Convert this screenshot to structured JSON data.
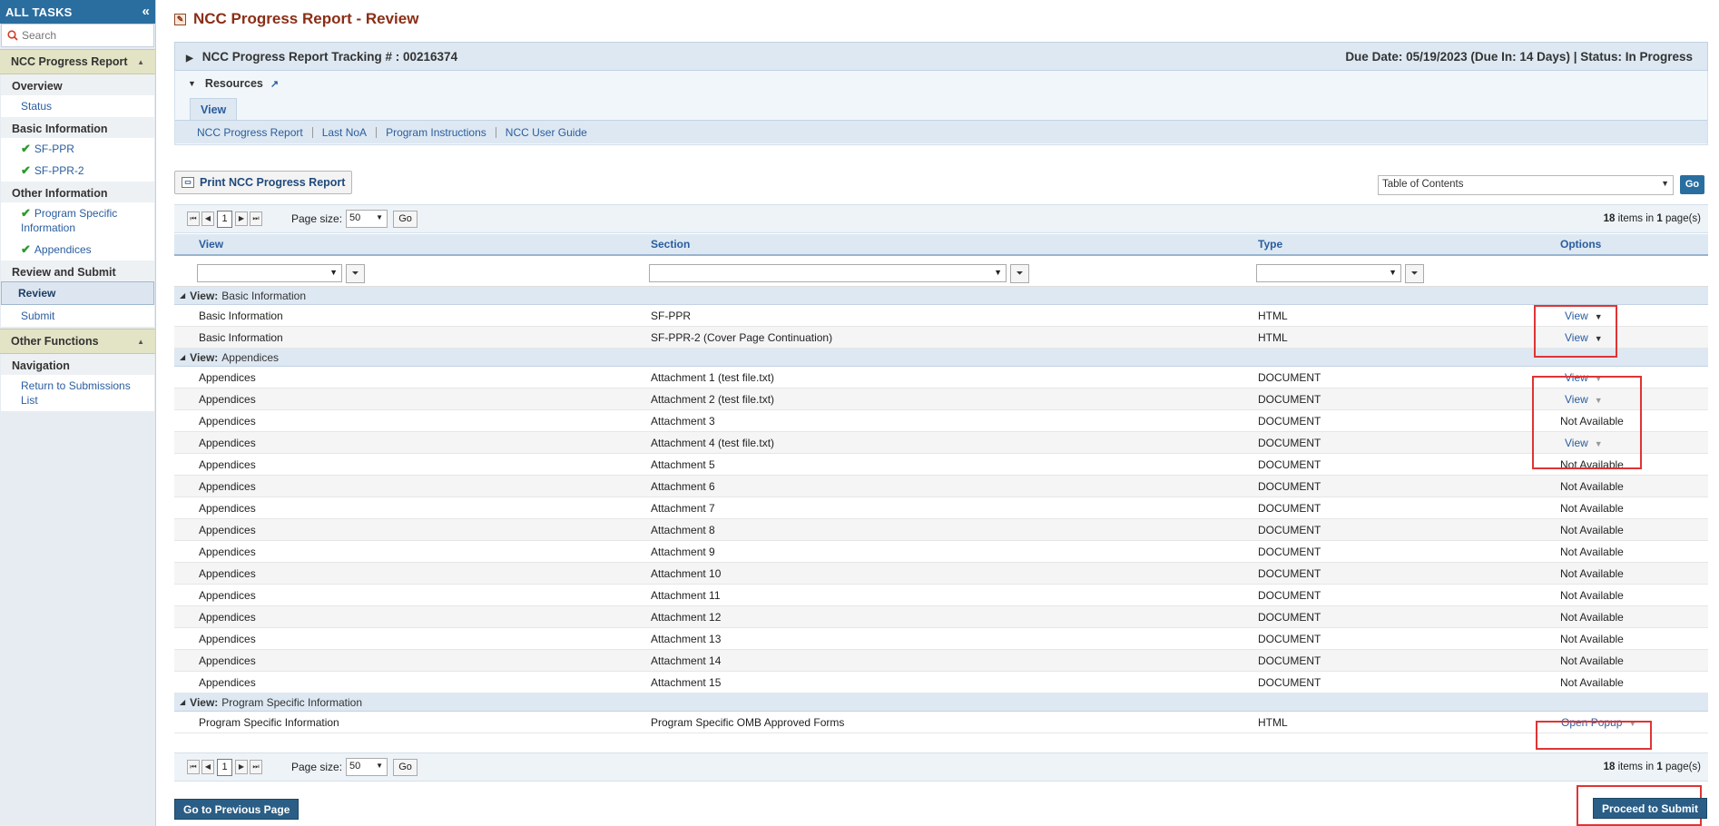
{
  "sidebar": {
    "header": "ALL TASKS",
    "collapse_icon": "double-chevron-left-icon",
    "search_placeholder": "Search",
    "groups": [
      {
        "title": "NCC Progress Report",
        "sections": [
          {
            "title": "Overview",
            "items": [
              {
                "label": "Status",
                "check": false
              }
            ]
          },
          {
            "title": "Basic Information",
            "items": [
              {
                "label": "SF-PPR",
                "check": true
              },
              {
                "label": "SF-PPR-2",
                "check": true
              }
            ]
          },
          {
            "title": "Other Information",
            "items": [
              {
                "label": "Program Specific Information",
                "check": true
              },
              {
                "label": "Appendices",
                "check": true
              }
            ]
          },
          {
            "title": "Review and Submit",
            "items": [
              {
                "label": "Review",
                "active": true
              },
              {
                "label": "Submit"
              }
            ]
          }
        ]
      },
      {
        "title": "Other Functions",
        "sections": [
          {
            "title": "Navigation",
            "items": [
              {
                "label": "Return to Submissions List"
              }
            ]
          }
        ]
      }
    ]
  },
  "page": {
    "title": "NCC Progress Report - Review",
    "tracking_label": "NCC Progress Report Tracking # : 00216374",
    "due_prefix": "Due Date: 05/19/2023 ",
    "due_in": "(Due In: 14 Days)",
    "status": " | Status: In Progress"
  },
  "resources": {
    "title": "Resources",
    "tab": "View",
    "links": [
      "NCC Progress Report",
      "Last NoA",
      "Program Instructions",
      "NCC User Guide"
    ]
  },
  "toolbar": {
    "print_label": "Print NCC Progress Report",
    "toc_value": "Table of Contents",
    "toc_go": "Go"
  },
  "pager": {
    "page": "1",
    "page_size_label": "Page size:",
    "page_size": "50",
    "go": "Go",
    "items_count": "18",
    "items_mid": " items in ",
    "pages_count": "1",
    "items_suffix": " page(s)"
  },
  "grid": {
    "columns": [
      "View",
      "Section",
      "Type",
      "Options"
    ],
    "group_prefix": "View:",
    "groups": [
      {
        "name": "Basic Information",
        "rows": [
          {
            "view": "Basic Information",
            "section": "SF-PPR",
            "type": "HTML",
            "option": "View",
            "dd": "dark"
          },
          {
            "view": "Basic Information",
            "section": "SF-PPR-2 (Cover Page Continuation)",
            "type": "HTML",
            "option": "View",
            "dd": "dark"
          }
        ]
      },
      {
        "name": "Appendices",
        "rows": [
          {
            "view": "Appendices",
            "section": "Attachment 1 (test file.txt)",
            "type": "DOCUMENT",
            "option": "View",
            "dd": "gray"
          },
          {
            "view": "Appendices",
            "section": "Attachment 2 (test file.txt)",
            "type": "DOCUMENT",
            "option": "View",
            "dd": "gray"
          },
          {
            "view": "Appendices",
            "section": "Attachment 3",
            "type": "DOCUMENT",
            "option": "Not Available"
          },
          {
            "view": "Appendices",
            "section": "Attachment 4 (test file.txt)",
            "type": "DOCUMENT",
            "option": "View",
            "dd": "gray"
          },
          {
            "view": "Appendices",
            "section": "Attachment 5",
            "type": "DOCUMENT",
            "option": "Not Available"
          },
          {
            "view": "Appendices",
            "section": "Attachment 6",
            "type": "DOCUMENT",
            "option": "Not Available"
          },
          {
            "view": "Appendices",
            "section": "Attachment 7",
            "type": "DOCUMENT",
            "option": "Not Available"
          },
          {
            "view": "Appendices",
            "section": "Attachment 8",
            "type": "DOCUMENT",
            "option": "Not Available"
          },
          {
            "view": "Appendices",
            "section": "Attachment 9",
            "type": "DOCUMENT",
            "option": "Not Available"
          },
          {
            "view": "Appendices",
            "section": "Attachment 10",
            "type": "DOCUMENT",
            "option": "Not Available"
          },
          {
            "view": "Appendices",
            "section": "Attachment 11",
            "type": "DOCUMENT",
            "option": "Not Available"
          },
          {
            "view": "Appendices",
            "section": "Attachment 12",
            "type": "DOCUMENT",
            "option": "Not Available"
          },
          {
            "view": "Appendices",
            "section": "Attachment 13",
            "type": "DOCUMENT",
            "option": "Not Available"
          },
          {
            "view": "Appendices",
            "section": "Attachment 14",
            "type": "DOCUMENT",
            "option": "Not Available"
          },
          {
            "view": "Appendices",
            "section": "Attachment 15",
            "type": "DOCUMENT",
            "option": "Not Available"
          }
        ]
      },
      {
        "name": "Program Specific Information",
        "rows": [
          {
            "view": "Program Specific Information",
            "section": "Program Specific OMB Approved Forms",
            "type": "HTML",
            "option": "Open Popup",
            "dd": "gray"
          }
        ]
      }
    ]
  },
  "footer": {
    "prev_label": "Go to Previous Page",
    "submit_label": "Proceed to Submit"
  },
  "colors": {
    "brand": "#2a6ea0",
    "title": "#8a2e16",
    "highlight": "#e03434",
    "link": "#2a5d9e"
  }
}
